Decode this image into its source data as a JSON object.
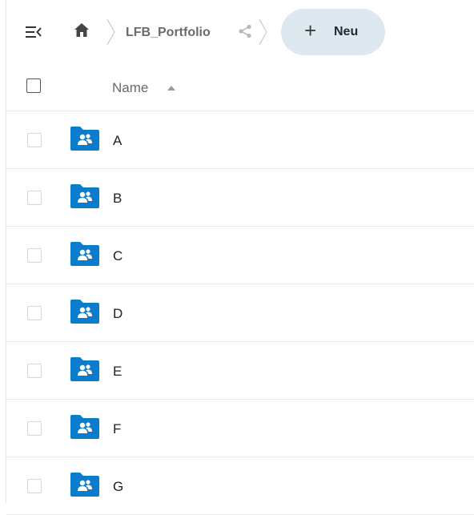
{
  "header": {
    "menu_icon": "sidebar-collapse-icon",
    "home_icon": "home-icon",
    "breadcrumb_label": "LFB_Portfolio",
    "share_icon": "share-icon",
    "new_button": {
      "icon": "plus-icon",
      "plus_symbol": "+",
      "label": "Neu"
    }
  },
  "list": {
    "column_name": "Name",
    "sort_direction": "ascending",
    "items": [
      {
        "name": "A",
        "icon": "shared-folder-icon"
      },
      {
        "name": "B",
        "icon": "shared-folder-icon"
      },
      {
        "name": "C",
        "icon": "shared-folder-icon"
      },
      {
        "name": "D",
        "icon": "shared-folder-icon"
      },
      {
        "name": "E",
        "icon": "shared-folder-icon"
      },
      {
        "name": "F",
        "icon": "shared-folder-icon"
      },
      {
        "name": "G",
        "icon": "shared-folder-icon"
      }
    ]
  },
  "colors": {
    "folder_blue": "#0a7ccc",
    "button_bg": "#dde8ef",
    "border": "#e8e8e8"
  }
}
